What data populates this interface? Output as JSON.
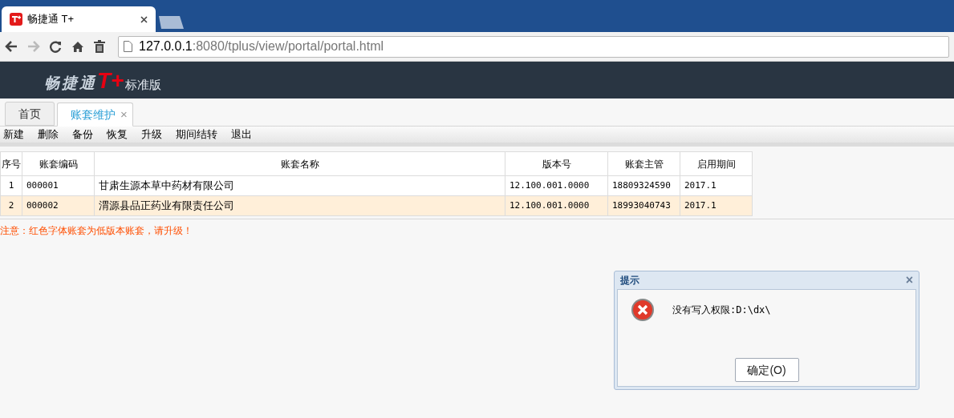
{
  "browser": {
    "tab_title": "畅捷通 T+",
    "url_host": "127.0.0.1",
    "url_rest": ":8080/tplus/view/portal/portal.html"
  },
  "header": {
    "brand": "畅捷通",
    "mark": "T+",
    "edition": "标准版"
  },
  "tabs": [
    {
      "label": "首页",
      "selected": false
    },
    {
      "label": "账套维护",
      "selected": true,
      "close": "×"
    }
  ],
  "toolbar": [
    "新建",
    "删除",
    "备份",
    "恢复",
    "升级",
    "期间结转",
    "退出"
  ],
  "table": {
    "columns": [
      "序号",
      "账套编码",
      "账套名称",
      "版本号",
      "账套主管",
      "启用期间"
    ],
    "rows": [
      {
        "selected": false,
        "cells": [
          "1",
          "000001",
          "甘肃生源本草中药材有限公司",
          "12.100.001.0000",
          "18809324590",
          "2017.1"
        ]
      },
      {
        "selected": true,
        "cells": [
          "2",
          "000002",
          "渭源县品正药业有限责任公司",
          "12.100.001.0000",
          "18993040743",
          "2017.1"
        ]
      }
    ]
  },
  "notice": "注意：红色字体账套为低版本账套，请升级！",
  "dialog": {
    "title": "提示",
    "close": "×",
    "message": "没有写入权限:D:\\dx\\",
    "button": "确定(O)"
  }
}
